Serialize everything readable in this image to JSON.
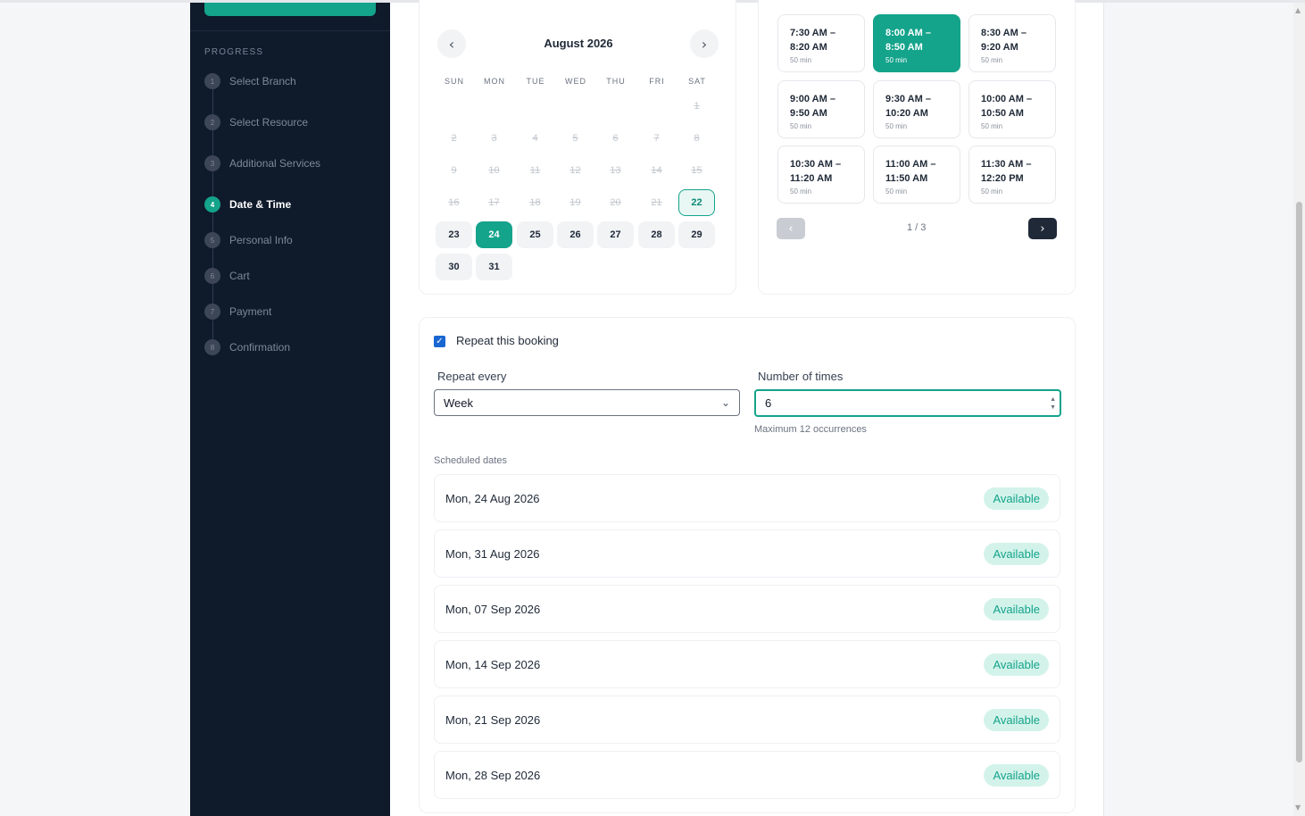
{
  "sidebar": {
    "progress_label": "PROGRESS",
    "steps": [
      {
        "num": "1",
        "label": "Select Branch"
      },
      {
        "num": "2",
        "label": "Select Resource"
      },
      {
        "num": "3",
        "label": "Additional Services"
      },
      {
        "num": "4",
        "label": "Date & Time"
      },
      {
        "num": "5",
        "label": "Personal Info"
      },
      {
        "num": "6",
        "label": "Cart"
      },
      {
        "num": "7",
        "label": "Payment"
      },
      {
        "num": "8",
        "label": "Confirmation"
      }
    ],
    "active_step": 4
  },
  "calendar": {
    "month": "August 2026",
    "prev_icon": "chevron-left-icon",
    "next_icon": "chevron-right-icon",
    "weekdays": [
      "SUN",
      "MON",
      "TUE",
      "WED",
      "THU",
      "FRI",
      "SAT"
    ],
    "first_weekday_index": 6,
    "days_in_month": 31,
    "past_through": 21,
    "today": 22,
    "selected": 24
  },
  "time_slots": {
    "slots": [
      {
        "time": "7:30 AM – 8:20 AM",
        "start": "7:30 AM –",
        "end": "8:20 AM",
        "duration": "50 min"
      },
      {
        "time": "8:00 AM – 8:50 AM",
        "start": "8:00 AM –",
        "end": "8:50 AM",
        "duration": "50 min",
        "selected": true
      },
      {
        "time": "8:30 AM – 9:20 AM",
        "start": "8:30 AM –",
        "end": "9:20 AM",
        "duration": "50 min"
      },
      {
        "time": "9:00 AM – 9:50 AM",
        "start": "9:00 AM –",
        "end": "9:50 AM",
        "duration": "50 min"
      },
      {
        "time": "9:30 AM – 10:20 AM",
        "start": "9:30 AM –",
        "end": "10:20 AM",
        "duration": "50 min"
      },
      {
        "time": "10:00 AM – 10:50 AM",
        "start": "10:00 AM –",
        "end": "10:50 AM",
        "duration": "50 min"
      },
      {
        "time": "10:30 AM – 11:20 AM",
        "start": "10:30 AM –",
        "end": "11:20 AM",
        "duration": "50 min"
      },
      {
        "time": "11:00 AM – 11:50 AM",
        "start": "11:00 AM –",
        "end": "11:50 AM",
        "duration": "50 min"
      },
      {
        "time": "11:30 AM – 12:20 PM",
        "start": "11:30 AM –",
        "end": "12:20 PM",
        "duration": "50 min"
      }
    ],
    "page_label": "1 / 3"
  },
  "repeat": {
    "checkbox_label": "Repeat this booking",
    "checked": true,
    "repeat_every_label": "Repeat every",
    "repeat_every_value": "Week",
    "number_of_times_label": "Number of times",
    "number_of_times_value": "6",
    "hint": "Maximum 12 occurrences",
    "scheduled_label": "Scheduled dates",
    "scheduled": [
      {
        "date": "Mon, 24 Aug 2026",
        "status": "Available"
      },
      {
        "date": "Mon, 31 Aug 2026",
        "status": "Available"
      },
      {
        "date": "Mon, 07 Sep 2026",
        "status": "Available"
      },
      {
        "date": "Mon, 14 Sep 2026",
        "status": "Available"
      },
      {
        "date": "Mon, 21 Sep 2026",
        "status": "Available"
      },
      {
        "date": "Mon, 28 Sep 2026",
        "status": "Available"
      }
    ]
  },
  "colors": {
    "accent": "#14a38b",
    "sidebar_bg": "#0f1a2b",
    "badge_bg": "#d3f3ea"
  }
}
